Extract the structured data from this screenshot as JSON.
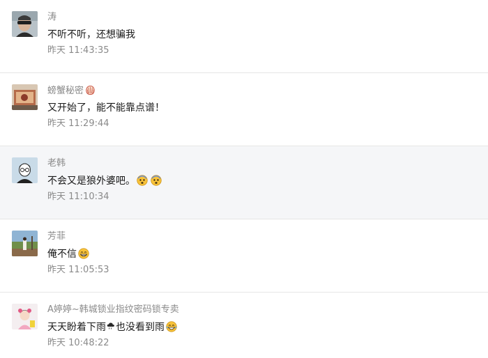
{
  "comments": [
    {
      "nickname": "涛",
      "content": "不听不听，还想骗我",
      "time": "昨天 11:43:35",
      "avatar_icon": "avatar-photo-man-sunglasses"
    },
    {
      "nickname": "螃蟹秘密",
      "nickname_emoji": "shell-icon",
      "content": "又开始了，能不能靠点谱！",
      "time": "昨天 11:29:44",
      "avatar_icon": "avatar-photo-rug"
    },
    {
      "nickname": "老韩",
      "content": "不会又是狼外婆吧。",
      "content_emojis": [
        "shocked-face-icon",
        "shocked-face-icon"
      ],
      "time": "昨天 11:10:34",
      "avatar_icon": "avatar-cartoon-glasses"
    },
    {
      "nickname": "芳菲",
      "content": "俺不信",
      "content_emojis": [
        "grin-face-icon"
      ],
      "time": "昨天 11:05:53",
      "avatar_icon": "avatar-photo-field"
    },
    {
      "nickname": "A婷婷~韩城锁业指纹密码锁专卖",
      "content_part1": "天天盼着下雨",
      "content_part2": "也没看到雨",
      "content_emojis": [
        "cloud-rain-icon",
        "laughing-tears-face-icon"
      ],
      "time": "昨天 10:48:22",
      "avatar_icon": "avatar-photo-girl"
    }
  ],
  "colors": {
    "nickname": "#8a8a8a",
    "time": "#8a8a8a",
    "content": "#1a1a1a",
    "highlight_bg": "#f5f6f8",
    "divider": "#e6e6e6"
  }
}
